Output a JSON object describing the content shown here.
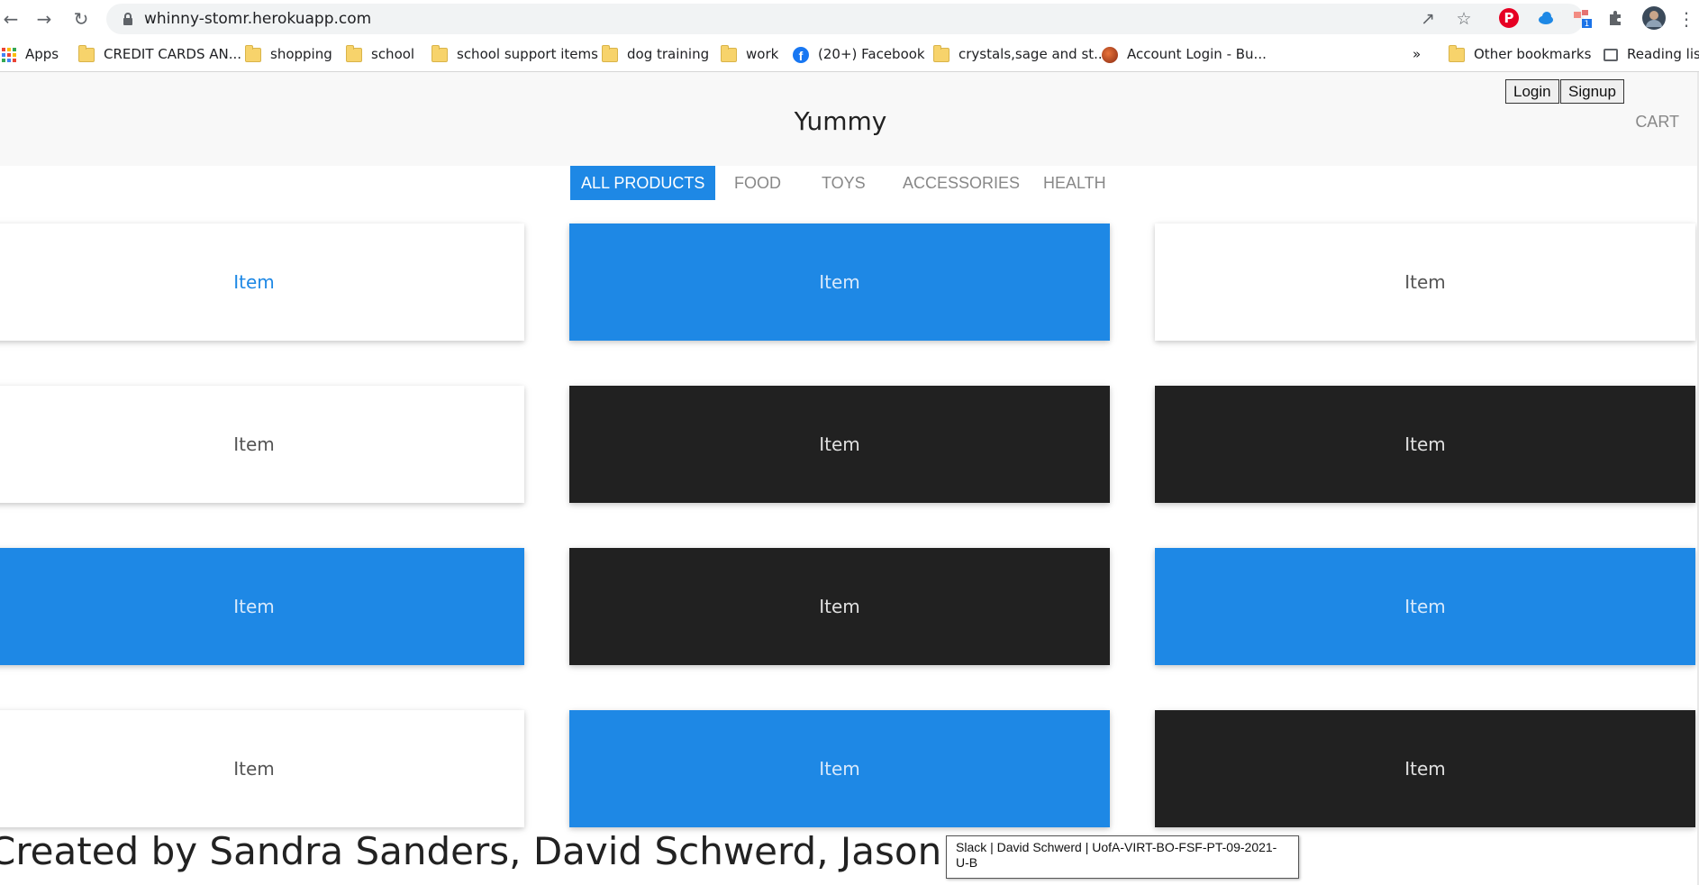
{
  "browser": {
    "url": "whinny-stomr.herokuapp.com",
    "bookmarks": [
      {
        "label": "Apps",
        "icon": "apps-grid-icon"
      },
      {
        "label": "CREDIT CARDS AN...",
        "icon": "folder-icon"
      },
      {
        "label": "shopping",
        "icon": "folder-icon"
      },
      {
        "label": "school",
        "icon": "folder-icon"
      },
      {
        "label": "school support items",
        "icon": "folder-icon"
      },
      {
        "label": "dog training",
        "icon": "folder-icon"
      },
      {
        "label": "work",
        "icon": "folder-icon"
      },
      {
        "label": "(20+) Facebook",
        "icon": "facebook-icon"
      },
      {
        "label": "crystals,sage and st...",
        "icon": "folder-icon"
      },
      {
        "label": "Account Login - Bu...",
        "icon": "site-icon"
      }
    ],
    "overflow": "»",
    "other_bookmarks": "Other bookmarks",
    "reading_list": "Reading list",
    "extension_badge": "1"
  },
  "site": {
    "title": "Yummy",
    "login": "Login",
    "signup": "Signup",
    "cart": "CART"
  },
  "categories": [
    {
      "label": "ALL PRODUCTS",
      "active": true
    },
    {
      "label": "FOOD",
      "active": false
    },
    {
      "label": "TOYS",
      "active": false
    },
    {
      "label": "ACCESSORIES",
      "active": false
    },
    {
      "label": "HEALTH",
      "active": false
    }
  ],
  "products": [
    {
      "label": "Item",
      "style": "white-link"
    },
    {
      "label": "Item",
      "style": "blue"
    },
    {
      "label": "Item",
      "style": "white"
    },
    {
      "label": "Item",
      "style": "white"
    },
    {
      "label": "Item",
      "style": "black"
    },
    {
      "label": "Item",
      "style": "black"
    },
    {
      "label": "Item",
      "style": "blue"
    },
    {
      "label": "Item",
      "style": "black"
    },
    {
      "label": "Item",
      "style": "blue"
    },
    {
      "label": "Item",
      "style": "white"
    },
    {
      "label": "Item",
      "style": "blue"
    },
    {
      "label": "Item",
      "style": "black"
    }
  ],
  "footer": {
    "credits": "Created by Sandra Sanders, David Schwerd, Jason Offenbaker"
  },
  "tooltip": {
    "text": "Slack | David Schwerd | UofA-VIRT-BO-FSF-PT-09-2021-U-B"
  },
  "colors": {
    "accent_blue": "#1e88e5",
    "card_black": "#212121",
    "header_bg": "#f8f8f8"
  }
}
